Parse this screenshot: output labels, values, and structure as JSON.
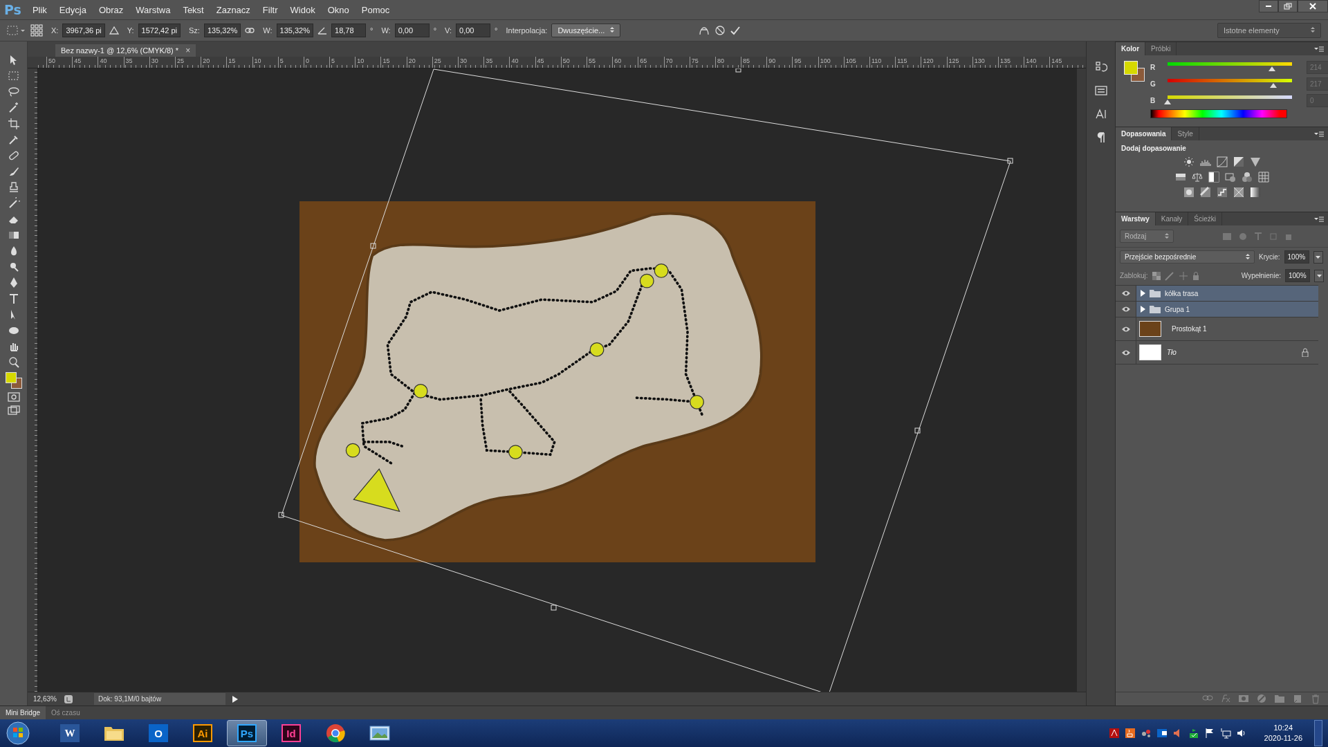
{
  "app": {
    "logo": "Ps"
  },
  "menu": [
    {
      "label": "Plik"
    },
    {
      "label": "Edycja"
    },
    {
      "label": "Obraz"
    },
    {
      "label": "Warstwa"
    },
    {
      "label": "Tekst"
    },
    {
      "label": "Zaznacz"
    },
    {
      "label": "Filtr"
    },
    {
      "label": "Widok"
    },
    {
      "label": "Okno"
    },
    {
      "label": "Pomoc"
    }
  ],
  "options_bar": {
    "fields": [
      {
        "label": "X:",
        "value": "3967,36 pi"
      },
      {
        "label": "Y:",
        "value": "1572,42 pi"
      },
      {
        "label": "Sz:",
        "value": "135,32%"
      },
      {
        "label": "W:",
        "value": "135,32%"
      },
      {
        "value": "18,78",
        "unit": "°"
      },
      {
        "label": "W:",
        "value": "0,00",
        "unit": "°"
      },
      {
        "label": "V:",
        "value": "0,00",
        "unit": "°"
      }
    ],
    "interpolation": {
      "label": "Interpolacja:",
      "value": "Dwuszęście..."
    },
    "workspace": "Istotne elementy"
  },
  "document_tab": {
    "title": "Bez nazwy-1 @ 12,6% (CMYK/8) *",
    "close": "×"
  },
  "ruler_labels": [
    "50",
    "45",
    "40",
    "35",
    "30",
    "25",
    "20",
    "15",
    "10",
    "5",
    "0",
    "5",
    "10",
    "15",
    "20",
    "25",
    "30",
    "35",
    "40",
    "45",
    "50",
    "55",
    "60",
    "65",
    "70",
    "75",
    "80",
    "85",
    "90",
    "95",
    "100",
    "105",
    "110",
    "115",
    "120",
    "125",
    "130",
    "135",
    "140",
    "145"
  ],
  "status_bar": {
    "zoom": "12,63%",
    "info": "Dok: 93,1M/0 bajtów"
  },
  "bottom_tabs": [
    {
      "label": "Mini Bridge",
      "selected": true
    },
    {
      "label": "Oś czasu",
      "selected": false
    }
  ],
  "color_panel": {
    "tabs": [
      {
        "label": "Kolor",
        "selected": true
      },
      {
        "label": "Próbki",
        "selected": false
      }
    ],
    "channels": [
      {
        "name": "R",
        "level": 0.839,
        "value": "214"
      },
      {
        "name": "G",
        "level": 0.851,
        "value": "217"
      },
      {
        "name": "B",
        "level": 0,
        "value": "0"
      }
    ]
  },
  "adjustments_panel": {
    "tabs": [
      {
        "label": "Dopasowania",
        "selected": true
      },
      {
        "label": "Style",
        "selected": false
      }
    ],
    "heading": "Dodaj dopasowanie"
  },
  "layers_panel": {
    "tabs": [
      {
        "label": "Warstwy",
        "selected": true
      },
      {
        "label": "Kanały",
        "selected": false
      },
      {
        "label": "Ścieżki",
        "selected": false
      }
    ],
    "filter": "Rodzaj",
    "blend_mode": "Przejście bezpośrednie",
    "opacity_label": "Krycie:",
    "opacity": "100%",
    "lock_label": "Zablokuj:",
    "fill_label": "Wypełnienie:",
    "fill": "100%",
    "layers": [
      {
        "name": "kółka trasa",
        "kind": "group",
        "selected": true,
        "visible": true,
        "locked": false
      },
      {
        "name": "Grupa 1",
        "kind": "group",
        "selected": true,
        "visible": true,
        "locked": false
      },
      {
        "name": "Prostokąt 1",
        "kind": "shape",
        "selected": false,
        "visible": true,
        "locked": false
      },
      {
        "name": "Tło",
        "kind": "background",
        "selected": false,
        "visible": true,
        "locked": true
      }
    ]
  },
  "taskbar": {
    "apps": [
      {
        "kind": "word",
        "label": "W",
        "active": false
      },
      {
        "kind": "explorer",
        "active": false
      },
      {
        "kind": "outlook",
        "label": "O",
        "active": false
      },
      {
        "kind": "illustrator",
        "label": "Ai",
        "active": false
      },
      {
        "kind": "photoshop",
        "label": "Ps",
        "active": true
      },
      {
        "kind": "indesign",
        "label": "Id",
        "active": false
      },
      {
        "kind": "chrome",
        "active": false
      },
      {
        "kind": "photos",
        "active": false
      }
    ],
    "time": "10:24",
    "date": "2020-11-26"
  }
}
